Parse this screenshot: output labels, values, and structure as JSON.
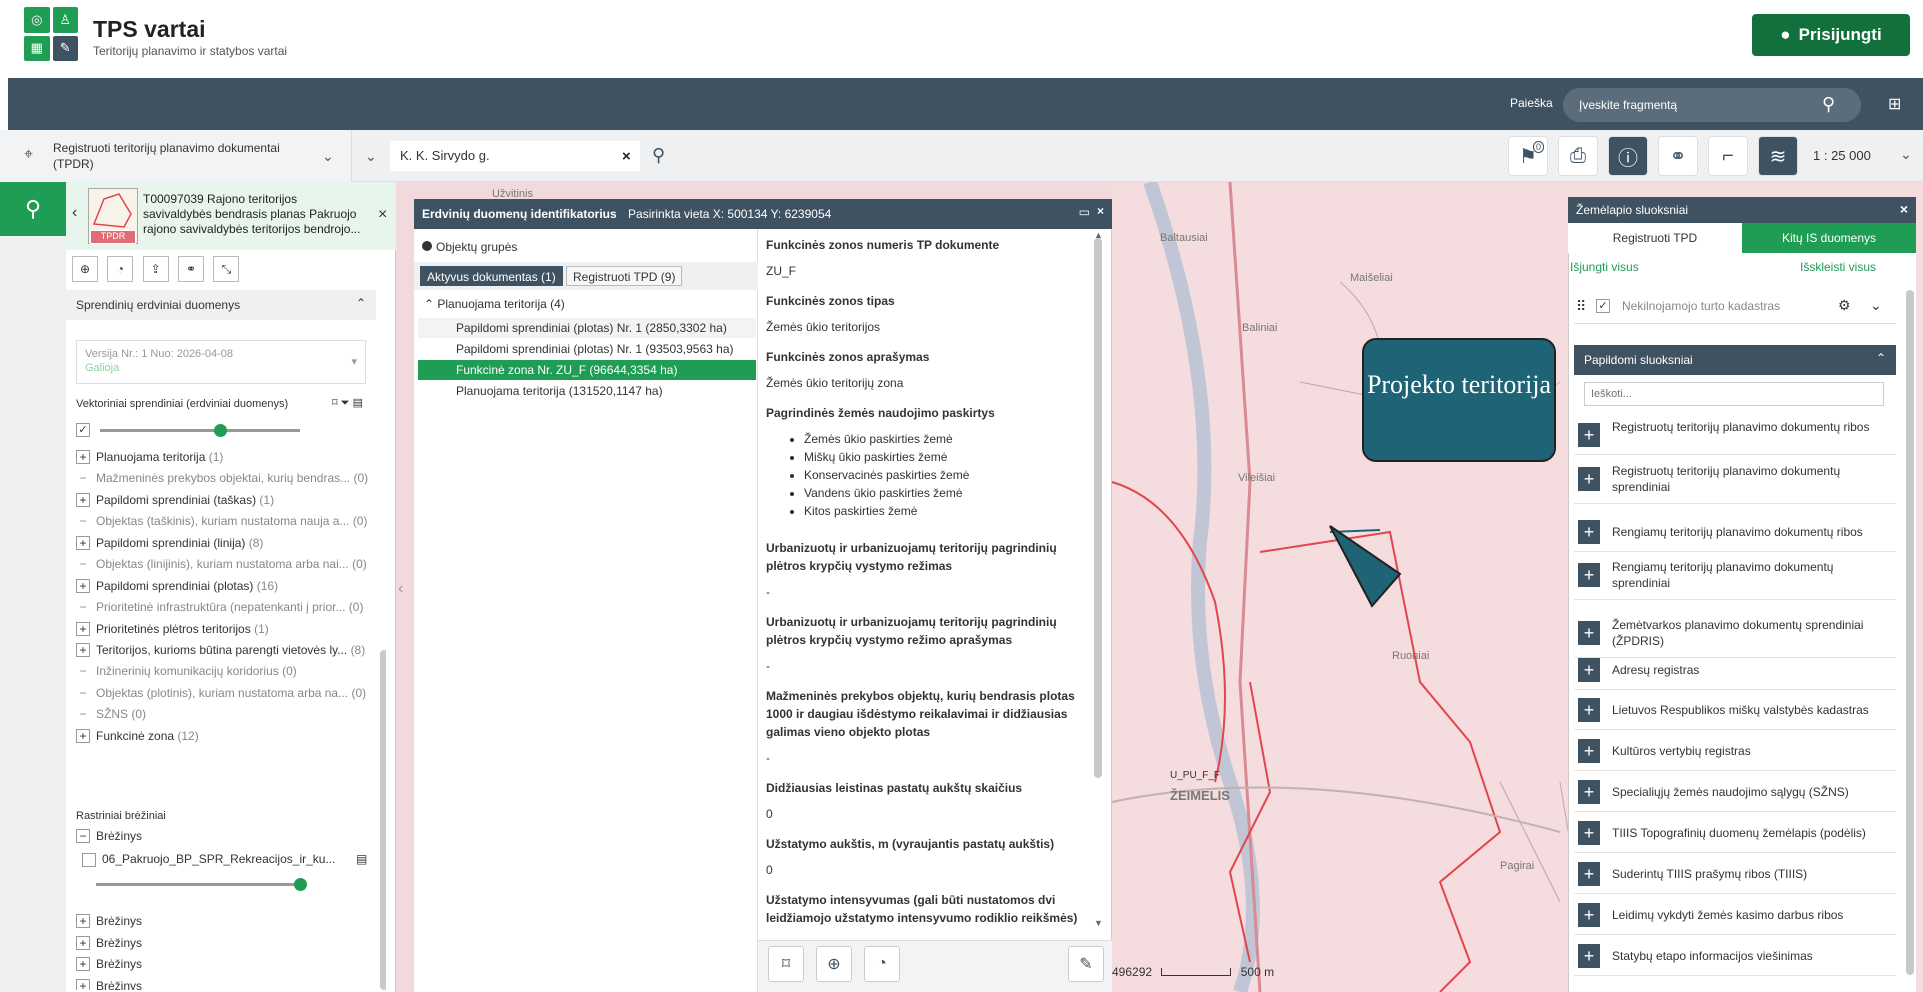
{
  "header": {
    "title": "TPS vartai",
    "subtitle": "Teritorijų planavimo ir statybos vartai",
    "login_label": "Prisijungti"
  },
  "search": {
    "label": "Paieška",
    "placeholder": "Įveskite fragmentą"
  },
  "toolbar": {
    "doc_type": "Registruoti teritorijų planavimo dokumentai (TPDR)",
    "address": "K. K. Sirvydo g.",
    "bookmark_badge": "0",
    "scale": "1 : 25 000"
  },
  "left_panel": {
    "doc_title": "T00097039 Rajono teritorijos savivaldybės bendrasis planas Pakruojo rajono savivaldybės teritorijos bendrojo...",
    "thumb_badge": "TPDR",
    "section_title": "Sprendinių erdviniai duomenys",
    "version_label": "Versija Nr.: 1 Nuo: 2026-04-08",
    "version_status": "Galioja",
    "vector_label": "Vektoriniai sprendiniai (erdviniai duomenys)",
    "vector_opacity": 0.6,
    "rows": [
      {
        "sign": "+",
        "label": "Planuojama teritorija",
        "count": "(1)",
        "muted": false
      },
      {
        "sign": "−",
        "label": "Mažmeninės prekybos objektai, kurių bendras...",
        "count": "(0)",
        "muted": true
      },
      {
        "sign": "+",
        "label": "Papildomi sprendiniai (taškas)",
        "count": "(1)",
        "muted": false
      },
      {
        "sign": "−",
        "label": "Objektas (taškinis), kuriam nustatoma nauja a...",
        "count": "(0)",
        "muted": true
      },
      {
        "sign": "+",
        "label": "Papildomi sprendiniai (linija)",
        "count": "(8)",
        "muted": false
      },
      {
        "sign": "−",
        "label": "Objektas (linijinis), kuriam nustatoma arba nai...",
        "count": "(0)",
        "muted": true
      },
      {
        "sign": "+",
        "label": "Papildomi sprendiniai (plotas)",
        "count": "(16)",
        "muted": false
      },
      {
        "sign": "−",
        "label": "Prioritetinė infrastruktūra (nepatenkanti į prior...",
        "count": "(0)",
        "muted": true
      },
      {
        "sign": "+",
        "label": "Prioritetinės plėtros teritorijos",
        "count": "(1)",
        "muted": false
      },
      {
        "sign": "+",
        "label": "Teritorijos, kurioms būtina parengti vietovės ly...",
        "count": "(8)",
        "muted": false
      },
      {
        "sign": "−",
        "label": "Inžinerinių komunikacijų koridorius",
        "count": "(0)",
        "muted": true
      },
      {
        "sign": "−",
        "label": "Objektas (plotinis), kuriam nustatoma arba na...",
        "count": "(0)",
        "muted": true
      },
      {
        "sign": "−",
        "label": "SŽNS",
        "count": "(0)",
        "muted": true
      },
      {
        "sign": "+",
        "label": "Funkcinė zona",
        "count": "(12)",
        "muted": false
      }
    ],
    "raster_label": "Rastriniai brėžiniai",
    "raster_group": "Brėžinys",
    "raster_file": "06_Pakruojo_BP_SPR_Rekreacijos_ir_ku...",
    "raster_opacity": 1.0,
    "drawings": [
      "Brėžinys",
      "Brėžinys",
      "Brėžinys",
      "Brėžinys",
      "Brėžinys"
    ]
  },
  "identifier": {
    "title": "Erdvinių duomenų identifikatorius",
    "location": "Pasirinkta vieta X: 500134 Y: 6239054",
    "object_groups": "Objektų grupės",
    "tab_active": "Aktyvus dokumentas (1)",
    "tab_registered": "Registruoti TPD (9)",
    "group": "Planuojama teritorija (4)",
    "items": [
      "Papildomi sprendiniai (plotas) Nr. 1 (2850,3302 ha)",
      "Papildomi sprendiniai (plotas) Nr. 1 (93503,9563 ha)",
      "Funkcinė zona Nr. ZU_F (96644,3354 ha)",
      "Planuojama teritorija (131520,1147 ha)"
    ],
    "attrs": [
      {
        "label": "Funkcinės zonos numeris TP dokumente",
        "value": "ZU_F"
      },
      {
        "label": "Funkcinės zonos tipas",
        "value": "Žemės ūkio teritorijos"
      },
      {
        "label": "Funkcinės zonos aprašymas",
        "value": "Žemės ūkio teritorijų zona"
      },
      {
        "label": "Pagrindinės žemės naudojimo paskirtys",
        "value": ""
      },
      {
        "label": "Urbanizuotų ir urbanizuojamų teritorijų pagrindinių plėtros krypčių vystymo režimas",
        "value": "-"
      },
      {
        "label": "Urbanizuotų ir urbanizuojamų teritorijų pagrindinių plėtros krypčių vystymo režimo aprašymas",
        "value": "-"
      },
      {
        "label": "Mažmeninės prekybos objektų, kurių bendrasis plotas 1000 ir daugiau išdėstymo reikalavimai ir didžiausias galimas vieno objekto plotas",
        "value": "-"
      },
      {
        "label": "Didžiausias leistinas pastatų aukštų skaičius",
        "value": "0"
      },
      {
        "label": "Užstatymo aukštis, m (vyraujantis pastatų aukštis)",
        "value": "0"
      },
      {
        "label": "Užstatymo intensyvumas (gali būti nustatomos dvi leidžiamojo užstatymo intensyvumo rodiklio reikšmės)",
        "value": ""
      }
    ],
    "land_uses": [
      "Žemės ūkio paskirties žemė",
      "Miškų ūkio paskirties žemė",
      "Konservacinės paskirties žemė",
      "Vandens ūkio paskirties žemė",
      "Kitos paskirties žemė"
    ]
  },
  "layers": {
    "title": "Žemėlapio sluoksniai",
    "tab_registered": "Registruoti TPD",
    "tab_other": "Kitų IS duomenys",
    "off_all": "Išjungti visus",
    "expand_all": "Išskleisti visus",
    "cadastre": "Nekilnojamojo turto kadastras",
    "extra_title": "Papildomi sluoksniai",
    "search_placeholder": "Ieškoti...",
    "items": [
      "Registruotų teritorijų planavimo dokumentų ribos",
      "Registruotų teritorijų planavimo dokumentų sprendiniai",
      "Rengiamų teritorijų planavimo dokumentų ribos",
      "Rengiamų teritorijų planavimo dokumentų sprendiniai",
      "Žemėtvarkos planavimo dokumentų sprendiniai (ŽPDRIS)",
      "Adresų registras",
      "Lietuvos Respublikos miškų valstybės kadastras",
      "Kultūros vertybių registras",
      "Specialiųjų žemės naudojimo sąlygų (SŽNS)",
      "TIIIS Topografinių duomenų žemėlapis (podėlis)",
      "Suderintų TIIIS prašymų ribos (TIIIS)",
      "Leidimų vykdyti žemės kasimo darbus ribos",
      "Statybų etapo informacijos viešinimas"
    ]
  },
  "map": {
    "callout": "Projekto teritorija",
    "labels": {
      "uzvitinis": "Užvitinis",
      "baltausiai": "Baltausiai",
      "maiseliai": "Maišeliai",
      "baliniai": "Baliniai",
      "vileisiai": "Vileišiai",
      "ruoniai": "Ruoniai",
      "zeimelis": "ŽEIMELIS",
      "zone_code": "U_PU_F_F",
      "pagirai": "Pagirai"
    },
    "coord": "496292",
    "scalebar": "500 m"
  },
  "colors": {
    "brand_green": "#1f9d55",
    "dark_slate": "#3f5261",
    "map_pink": "#f2d9dd",
    "boundary_red": "#e0474c"
  }
}
